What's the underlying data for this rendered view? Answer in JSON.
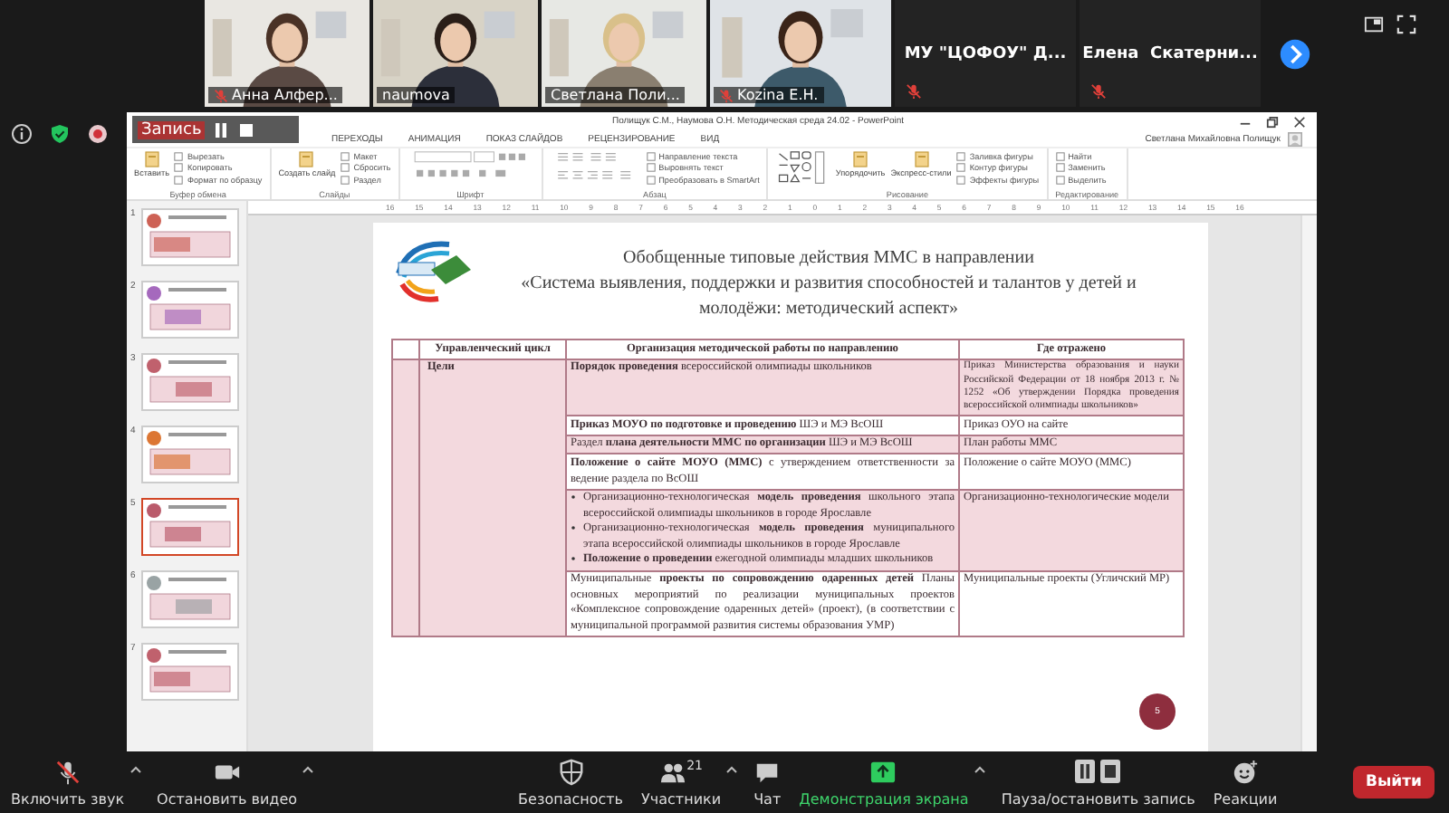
{
  "participants": [
    {
      "kind": "video",
      "name": "Анна Алфер...",
      "muted": true
    },
    {
      "kind": "video",
      "name": "naumova",
      "muted": false
    },
    {
      "kind": "video",
      "name": "Светлана Поли...",
      "muted": false
    },
    {
      "kind": "video",
      "name": "Kozina E.H.",
      "muted": true
    },
    {
      "kind": "name",
      "name": "МУ \"ЦОФОУ\" Д...",
      "muted": true
    },
    {
      "kind": "name",
      "name": "Елена  Скатерни...",
      "muted": true
    }
  ],
  "recording": {
    "label": "Запись"
  },
  "powerpoint": {
    "title": "Полищук С.М., Наумова О.Н. Методическая среда 24.02 - PowerPoint",
    "tabs": [
      "ПЕРЕХОДЫ",
      "АНИМАЦИЯ",
      "ПОКАЗ СЛАЙДОВ",
      "РЕЦЕНЗИРОВАНИЕ",
      "ВИД"
    ],
    "user": "Светлана Михайловна Полищук",
    "ribbon": [
      {
        "kind": "plain",
        "label": "Буфер обмена",
        "large": [
          "Вставить"
        ],
        "small": [
          "Вырезать",
          "Копировать",
          "Формат по образцу"
        ]
      },
      {
        "kind": "plain",
        "label": "Слайды",
        "large": [
          "Создать слайд"
        ],
        "small": [
          "Макет",
          "Сбросить",
          "Раздел"
        ]
      },
      {
        "kind": "font",
        "label": "Шрифт"
      },
      {
        "kind": "paragraph",
        "label": "Абзац",
        "small": [
          "Направление текста",
          "Выровнять текст",
          "Преобразовать в SmartArt"
        ]
      },
      {
        "kind": "drawing",
        "label": "Рисование",
        "large": [
          "Упорядочить",
          "Экспресс-стили"
        ],
        "small": [
          "Заливка фигуры",
          "Контур фигуры",
          "Эффекты фигуры"
        ]
      },
      {
        "kind": "plain",
        "label": "Редактирование",
        "small": [
          "Найти",
          "Заменить",
          "Выделить"
        ]
      }
    ],
    "ruler": [
      "16",
      "15",
      "14",
      "13",
      "12",
      "11",
      "10",
      "9",
      "8",
      "7",
      "6",
      "5",
      "4",
      "3",
      "2",
      "1",
      "0",
      "1",
      "2",
      "3",
      "4",
      "5",
      "6",
      "7",
      "8",
      "9",
      "10",
      "11",
      "12",
      "13",
      "14",
      "15",
      "16"
    ],
    "thumbnails": [
      {
        "number": "1",
        "selected": false
      },
      {
        "number": "2",
        "selected": false
      },
      {
        "number": "3",
        "selected": false
      },
      {
        "number": "4",
        "selected": false
      },
      {
        "number": "5",
        "selected": true
      },
      {
        "number": "6",
        "selected": false
      },
      {
        "number": "7",
        "selected": false
      }
    ],
    "slide": {
      "title_lines": [
        "Обобщенные типовые действия ММС в направлении",
        "«Система выявления, поддержки и развития способностей и талантов у детей и",
        "молодёжи: методический аспект»"
      ],
      "columns": [
        "Управленческий цикл",
        "Организация методической работы по направлению",
        "Где отражено"
      ],
      "cycle": "Цели",
      "rows": [
        {
          "shaded": true,
          "organization": {
            "kind": "paragraph",
            "text": "**Порядок проведения** всероссийской олимпиады школьников"
          },
          "where": "Приказ Министерства образования и науки Российской Федерации от 18 ноября 2013 г. № 1252 «Об утверждении Порядка проведения всероссийской олимпиады школьников»"
        },
        {
          "shaded": false,
          "organization": {
            "kind": "paragraph",
            "text": "**Приказ МОУО по подготовке и проведению** ШЭ и МЭ ВсОШ"
          },
          "where": "Приказ ОУО на сайте"
        },
        {
          "shaded": true,
          "organization": {
            "kind": "paragraph",
            "text": "Раздел **плана деятельности ММС по организации** ШЭ и МЭ ВсОШ"
          },
          "where": "План работы ММС"
        },
        {
          "shaded": false,
          "organization": {
            "kind": "paragraph",
            "text": "**Положение о сайте МОУО (ММС)** с утверждением ответственности за ведение раздела по ВсОШ"
          },
          "where": "Положение о сайте МОУО (ММС)"
        },
        {
          "shaded": true,
          "organization": {
            "kind": "bullets",
            "items": [
              "Организационно-технологическая **модель проведения** школьного этапа всероссийской олимпиады школьников в городе Ярославле",
              "Организационно-технологическая **модель проведения** муниципального этапа всероссийской олимпиады школьников в городе Ярославле",
              "**Положение о проведении** ежегодной олимпиады младших школьников"
            ]
          },
          "where": "Организационно-технологические модели"
        },
        {
          "shaded": false,
          "organization": {
            "kind": "paragraph",
            "text": "Муниципальные **проекты по сопровождению одаренных детей** Планы основных мероприятий по реализации муниципальных проектов «Комплексное сопровождение одаренных детей» (проект), (в соответствии с муниципальной программой развития системы образования УМР)"
          },
          "where": "Муниципальные проекты (Угличский МР)"
        }
      ],
      "page_number": "5"
    }
  },
  "toolbar": [
    {
      "kind": "mic",
      "label": "Включить звук",
      "caret": true
    },
    {
      "kind": "video",
      "label": "Остановить видео",
      "caret": true
    },
    {
      "kind": "security",
      "label": "Безопасность",
      "caret": false
    },
    {
      "kind": "participants",
      "label": "Участники",
      "count": "21",
      "caret": true
    },
    {
      "kind": "chat",
      "label": "Чат",
      "caret": false
    },
    {
      "kind": "share",
      "label": "Демонстрация экрана",
      "caret": true
    },
    {
      "kind": "record",
      "label": "Пауза/остановить запись",
      "caret": false
    },
    {
      "kind": "reactions",
      "label": "Реакции",
      "caret": false
    }
  ],
  "leave": "Выйти"
}
